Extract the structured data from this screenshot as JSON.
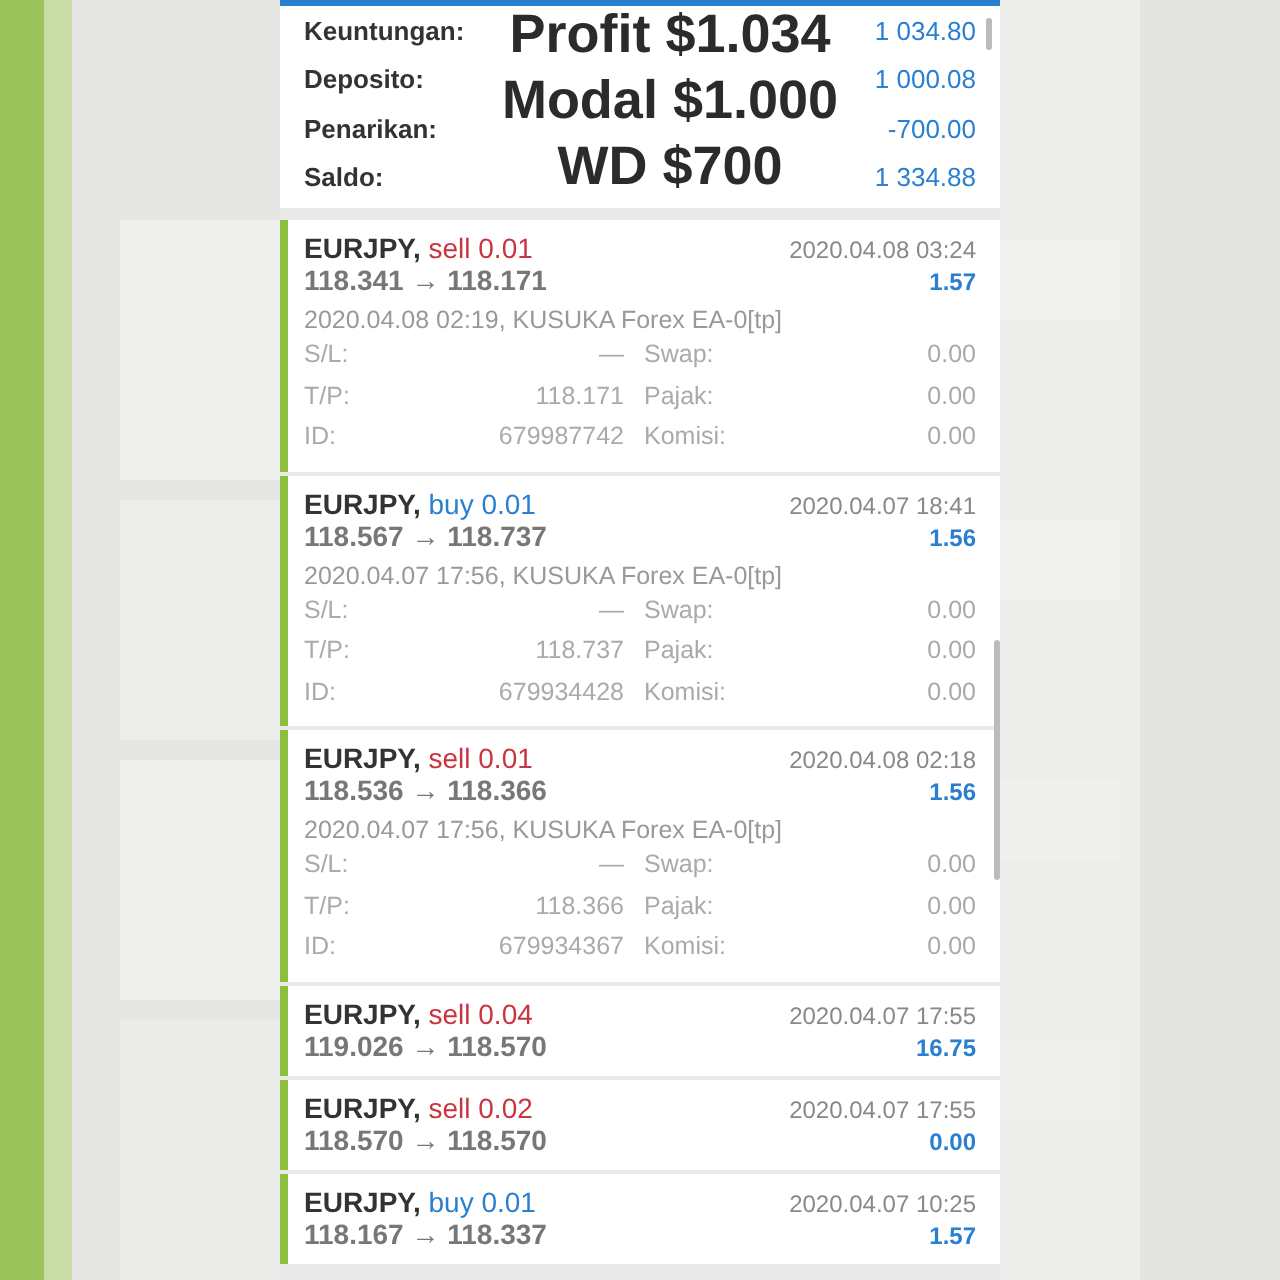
{
  "summary": {
    "rows": [
      {
        "label": "Keuntungan:",
        "value": "1 034.80"
      },
      {
        "label": "Deposito:",
        "value": "1 000.08"
      },
      {
        "label": "Penarikan:",
        "value": "-700.00"
      },
      {
        "label": "Saldo:",
        "value": "1 334.88"
      }
    ],
    "captions": [
      "Profit $1.034",
      "Modal $1.000",
      "WD $700"
    ]
  },
  "deals": [
    {
      "symbol": "EURJPY,",
      "order": "sell 0.01",
      "color": "#c9343f",
      "prices": "118.341 → 118.171",
      "time": "2020.04.08 03:24",
      "profit": "1.57",
      "expanded": true,
      "comment": "2020.04.08 02:19, KUSUKA Forex EA-0[tp]",
      "fields": [
        [
          "S/L:",
          "—",
          "Swap:",
          "0.00"
        ],
        [
          "T/P:",
          "118.171",
          "Pajak:",
          "0.00"
        ],
        [
          "ID:",
          "679987742",
          "Komisi:",
          "0.00"
        ]
      ]
    },
    {
      "symbol": "EURJPY,",
      "order": "buy 0.01",
      "color": "#2a7fd0",
      "prices": "118.567 → 118.737",
      "time": "2020.04.07 18:41",
      "profit": "1.56",
      "expanded": true,
      "comment": "2020.04.07 17:56, KUSUKA Forex EA-0[tp]",
      "fields": [
        [
          "S/L:",
          "—",
          "Swap:",
          "0.00"
        ],
        [
          "T/P:",
          "118.737",
          "Pajak:",
          "0.00"
        ],
        [
          "ID:",
          "679934428",
          "Komisi:",
          "0.00"
        ]
      ]
    },
    {
      "symbol": "EURJPY,",
      "order": "sell 0.01",
      "color": "#c9343f",
      "prices": "118.536 → 118.366",
      "time": "2020.04.08 02:18",
      "profit": "1.56",
      "expanded": true,
      "comment": "2020.04.07 17:56, KUSUKA Forex EA-0[tp]",
      "fields": [
        [
          "S/L:",
          "—",
          "Swap:",
          "0.00"
        ],
        [
          "T/P:",
          "118.366",
          "Pajak:",
          "0.00"
        ],
        [
          "ID:",
          "679934367",
          "Komisi:",
          "0.00"
        ]
      ]
    },
    {
      "symbol": "EURJPY,",
      "order": "sell 0.04",
      "color": "#c9343f",
      "prices": "119.026 → 118.570",
      "time": "2020.04.07 17:55",
      "profit": "16.75",
      "expanded": false
    },
    {
      "symbol": "EURJPY,",
      "order": "sell 0.02",
      "color": "#c9343f",
      "prices": "118.570 → 118.570",
      "time": "2020.04.07 17:55",
      "profit": "0.00",
      "expanded": false
    },
    {
      "symbol": "EURJPY,",
      "order": "buy 0.01",
      "color": "#2a7fd0",
      "prices": "118.167 → 118.337",
      "time": "2020.04.07 10:25",
      "profit": "1.57",
      "expanded": false
    }
  ]
}
